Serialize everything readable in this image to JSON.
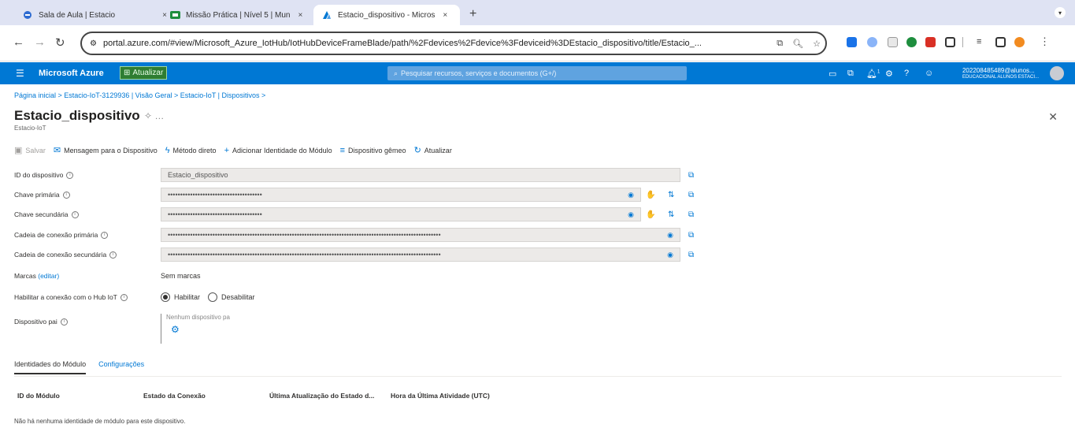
{
  "browser": {
    "tabs": [
      {
        "label": "Sala de Aula | Estacio",
        "close": "×"
      },
      {
        "label": "Missão Prática | Nível 5 | Mun",
        "close": "×"
      },
      {
        "label": "Estacio_dispositivo - Micros",
        "close": "×"
      }
    ],
    "new_tab": "+",
    "url": "portal.azure.com/#view/Microsoft_Azure_IotHub/IotHubDeviceFrameBlade/path/%2Fdevices%2Fdevice%3Fdeviceid%3DEstacio_dispositivo/title/Estacio_..."
  },
  "azure": {
    "brand": "Microsoft Azure",
    "upgrade_label": "Atualizar",
    "search_placeholder": "Pesquisar recursos, serviços e documentos (G+/)",
    "notification_count": "1",
    "user_email": "202208485489@alunos...",
    "user_org": "EDUCACIONAL ALUNOS ESTACI..."
  },
  "breadcrumb": "Página inicial > Estacio-IoT-3129936 | Visão Geral > Estacio-IoT | Dispositivos >",
  "page": {
    "title": "Estacio_dispositivo",
    "subtitle": "Estacio-IoT"
  },
  "toolbar": {
    "save": "Salvar",
    "message": "Mensagem para o Dispositivo",
    "direct_method": "Método direto",
    "add_module": "Adicionar Identidade do Módulo",
    "twin": "Dispositivo gêmeo",
    "refresh": "Atualizar"
  },
  "fields": {
    "device_id_label": "ID do dispositivo",
    "device_id_value": "Estacio_dispositivo",
    "primary_key_label": "Chave primária",
    "primary_key_value": "••••••••••••••••••••••••••••••••••••••",
    "secondary_key_label": "Chave secundária",
    "secondary_key_value": "••••••••••••••••••••••••••••••••••••••",
    "primary_conn_label": "Cadeia de conexão primária",
    "primary_conn_value": "••••••••••••••••••••••••••••••••••••••••••••••••••••••••••••••••••••••••••••••••••••••••••••••••••••••••••••••",
    "secondary_conn_label": "Cadeia de conexão secundária",
    "secondary_conn_value": "••••••••••••••••••••••••••••••••••••••••••••••••••••••••••••••••••••••••••••••••••••••••••••••••••••••••••••••",
    "tags_label": "Marcas",
    "tags_edit": "(editar)",
    "tags_value": "Sem marcas",
    "enable_label": "Habilitar a conexão com o Hub IoT",
    "enable_option": "Habilitar",
    "disable_option": "Desabilitar",
    "parent_label": "Dispositivo pai",
    "parent_value": "Nenhum dispositivo pa"
  },
  "module_tabs": {
    "identities": "Identidades do Módulo",
    "config": "Configurações"
  },
  "table": {
    "columns": [
      "ID do Módulo",
      "Estado da Conexão",
      "Última Atualização do Estado d...",
      "Hora da Última Atividade (UTC)"
    ],
    "empty": "Não há nenhuma identidade de módulo para este dispositivo."
  }
}
